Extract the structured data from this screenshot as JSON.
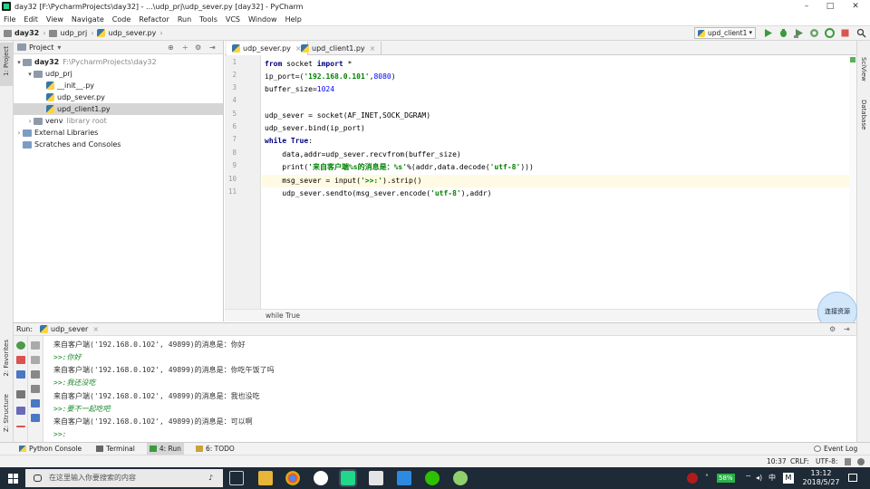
{
  "window": {
    "title": "day32 [F:\\PycharmProjects\\day32] - ...\\udp_prj\\udp_sever.py [day32] - PyCharm",
    "controls": [
      "–",
      "□",
      "✕"
    ]
  },
  "menu": [
    "File",
    "Edit",
    "View",
    "Navigate",
    "Code",
    "Refactor",
    "Run",
    "Tools",
    "VCS",
    "Window",
    "Help"
  ],
  "navbar": {
    "crumbs": [
      "day32",
      "udp_prj",
      "udp_sever.py"
    ],
    "run_config": "upd_client1"
  },
  "left_strip": {
    "project": "1: Project",
    "favorites": "2: Favorites",
    "structure": "Z: Structure"
  },
  "right_strip": {
    "sciview": "SciView",
    "database": "Database"
  },
  "project_panel": {
    "header": "Project",
    "tree": [
      {
        "label": "day32",
        "hint": "F:\\PycharmProjects\\day32"
      },
      {
        "label": "udp_prj",
        "hint": ""
      },
      {
        "label": "__init__.py",
        "hint": ""
      },
      {
        "label": "udp_sever.py",
        "hint": ""
      },
      {
        "label": "upd_client1.py",
        "hint": ""
      },
      {
        "label": "venv",
        "hint": "library root"
      },
      {
        "label": "External Libraries",
        "hint": ""
      },
      {
        "label": "Scratches and Consoles",
        "hint": ""
      }
    ]
  },
  "editor": {
    "tabs": [
      {
        "label": "udp_sever.py",
        "active": true
      },
      {
        "label": "upd_client1.py",
        "active": false
      }
    ],
    "line_numbers": [
      "1",
      "2",
      "3",
      "4",
      "5",
      "6",
      "7",
      "8",
      "9",
      "10",
      "11"
    ],
    "code": {
      "l1_kw1": "from",
      "l1_mid": " socket ",
      "l1_kw2": "import",
      "l1_end": " *",
      "l2_a": "ip_port=(",
      "l2_str": "'192.168.0.101'",
      "l2_b": ",",
      "l2_num": "8080",
      "l2_c": ")",
      "l3_a": "buffer_size=",
      "l3_num": "1024",
      "l5": "udp_sever = socket(AF_INET,SOCK_DGRAM)",
      "l6": "udp_sever.bind(ip_port)",
      "l7_kw": "while",
      "l7_sp": " ",
      "l7_kw2": "True",
      "l7_end": ":",
      "l8": "    data,addr=udp_sever.recvfrom(buffer_size)",
      "l9_a": "    print(",
      "l9_str": "'来自客户端%s的消息是：%s'",
      "l9_b": "%(addr,data.decode(",
      "l9_str2": "'utf-8'",
      "l9_c": ")))",
      "l10_a": "    msg_sever = input(",
      "l10_str": "'>>:'",
      "l10_b": ").strip()",
      "l11_a": "    udp_sever.sendto(msg_sever.encode(",
      "l11_str": "'utf-8'",
      "l11_b": "),addr)"
    },
    "breadcrumb": "while True"
  },
  "bubble": "连接资源",
  "run_panel": {
    "label": "Run:",
    "config": "udp_sever",
    "output": [
      {
        "text": "来自客户端('192.168.0.102', 49899)的消息是：你好",
        "input": false
      },
      {
        "text": ">>:你好",
        "input": true
      },
      {
        "text": "来自客户端('192.168.0.102', 49899)的消息是：你吃午饭了吗",
        "input": false
      },
      {
        "text": ">>:我还没吃",
        "input": true
      },
      {
        "text": "来自客户端('192.168.0.102', 49899)的消息是：我也没吃",
        "input": false
      },
      {
        "text": ">>:要不一起吃吧",
        "input": true
      },
      {
        "text": "来自客户端('192.168.0.102', 49899)的消息是：可以啊",
        "input": false
      },
      {
        "text": ">>:",
        "input": true
      }
    ]
  },
  "bottom_tabs": [
    "Python Console",
    "Terminal",
    "4: Run",
    "6: TODO"
  ],
  "event_log": "Event Log",
  "status": {
    "position": "10:37",
    "line_sep": "CRLF:",
    "encoding": "UTF-8:"
  },
  "taskbar": {
    "search_placeholder": "在这里输入你要搜索的内容",
    "battery": "58%",
    "ime": "中",
    "time": "13:12",
    "date": "2018/5/27"
  }
}
